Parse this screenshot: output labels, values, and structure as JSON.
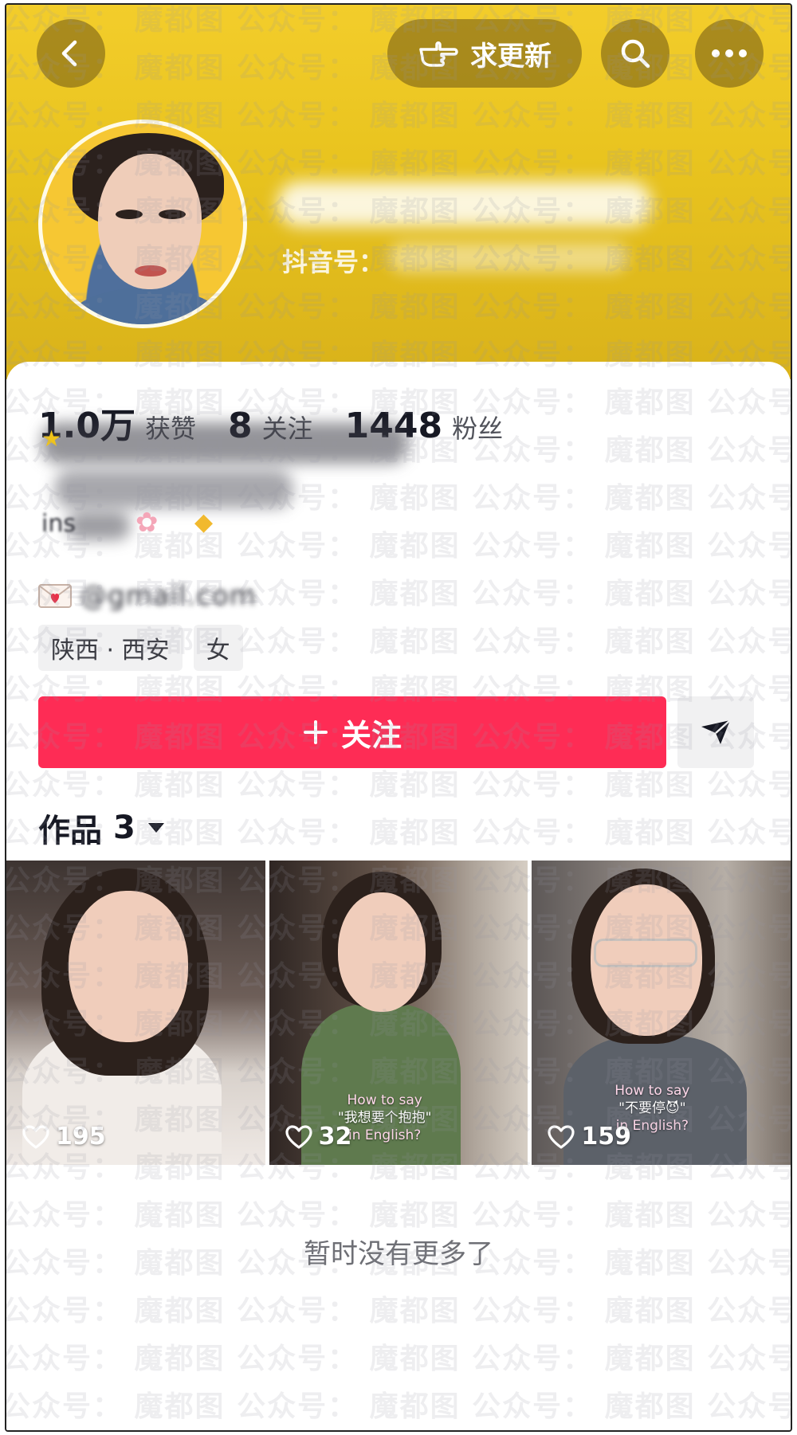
{
  "header": {
    "back_icon": "chevron-left-icon",
    "request_update_label": "求更新",
    "request_update_icon": "pointing-hand-icon",
    "search_icon": "search-icon",
    "more_icon": "ellipsis-icon",
    "douyin_id_label": "抖音号："
  },
  "stats": [
    {
      "value": "1.0万",
      "label": "获赞"
    },
    {
      "value": "8",
      "label": "关注"
    },
    {
      "value": "1448",
      "label": "粉丝"
    }
  ],
  "bio": {
    "email_icon": "love-letter-icon",
    "email": "@gmail.com",
    "prefix": "ins"
  },
  "tags": {
    "location": "陕西 · 西安",
    "gender": "女"
  },
  "actions": {
    "follow_label": "关注",
    "follow_icon": "plus-icon",
    "share_icon": "send-arrow-icon"
  },
  "works": {
    "label": "作品",
    "count": "3",
    "dropdown_icon": "caret-down-icon",
    "items": [
      {
        "likes": "195",
        "caption_top": "",
        "caption_mid": "",
        "caption_bottom": ""
      },
      {
        "likes": "32",
        "caption_top": "How to say",
        "caption_mid": "\"我想要个抱抱\"",
        "caption_bottom": "in English?"
      },
      {
        "likes": "159",
        "caption_top": "How to say",
        "caption_mid": "\"不要停😈\"",
        "caption_bottom": "in English?"
      }
    ]
  },
  "footer": {
    "end_text": "暂时没有更多了"
  },
  "watermark_text": "公众号： 魔都图",
  "colors": {
    "header_gold": "#e9c41f",
    "follow_red": "#fe2c55",
    "tag_bg": "#f1f1f2"
  }
}
